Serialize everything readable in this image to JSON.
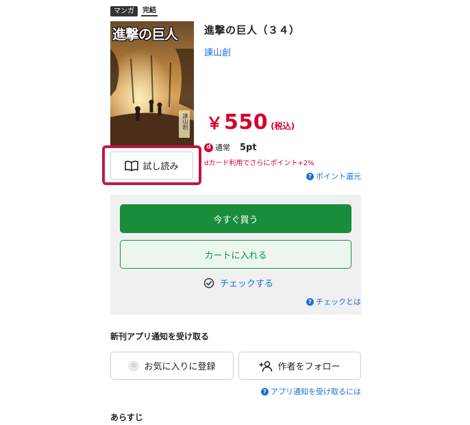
{
  "badges": {
    "genre": "マンガ",
    "status": "完結"
  },
  "book": {
    "cover_title": "進撃の巨人",
    "cover_author": "諫山創",
    "title": "進撃の巨人（３４）",
    "author": "諫山創"
  },
  "price": {
    "yen": "￥",
    "amount": "550",
    "tax": "(税込)"
  },
  "points": {
    "d_logo": "d",
    "type": "通常",
    "value": "5pt",
    "dcard_note": "dカード利用でさらにポイント+2%",
    "link": "ポイント還元"
  },
  "trial": {
    "label": "試し読み",
    "icon": "open-book-icon"
  },
  "purchase": {
    "buy_now": "今すぐ買う",
    "add_to_cart": "カートに入れる",
    "check": "チェックする",
    "check_about": "チェックとは"
  },
  "notify": {
    "heading": "新刊アプリ通知を受け取る",
    "favorite": "お気に入りに登録",
    "follow_author": "作者をフォロー",
    "about": "アプリ通知を受け取るには"
  },
  "synopsis": {
    "heading": "あらすじ"
  },
  "colors": {
    "accent_red": "#d4002a",
    "buy_green": "#1a8d3c",
    "link_blue": "#1a6ed8",
    "highlight": "#c0173e"
  }
}
